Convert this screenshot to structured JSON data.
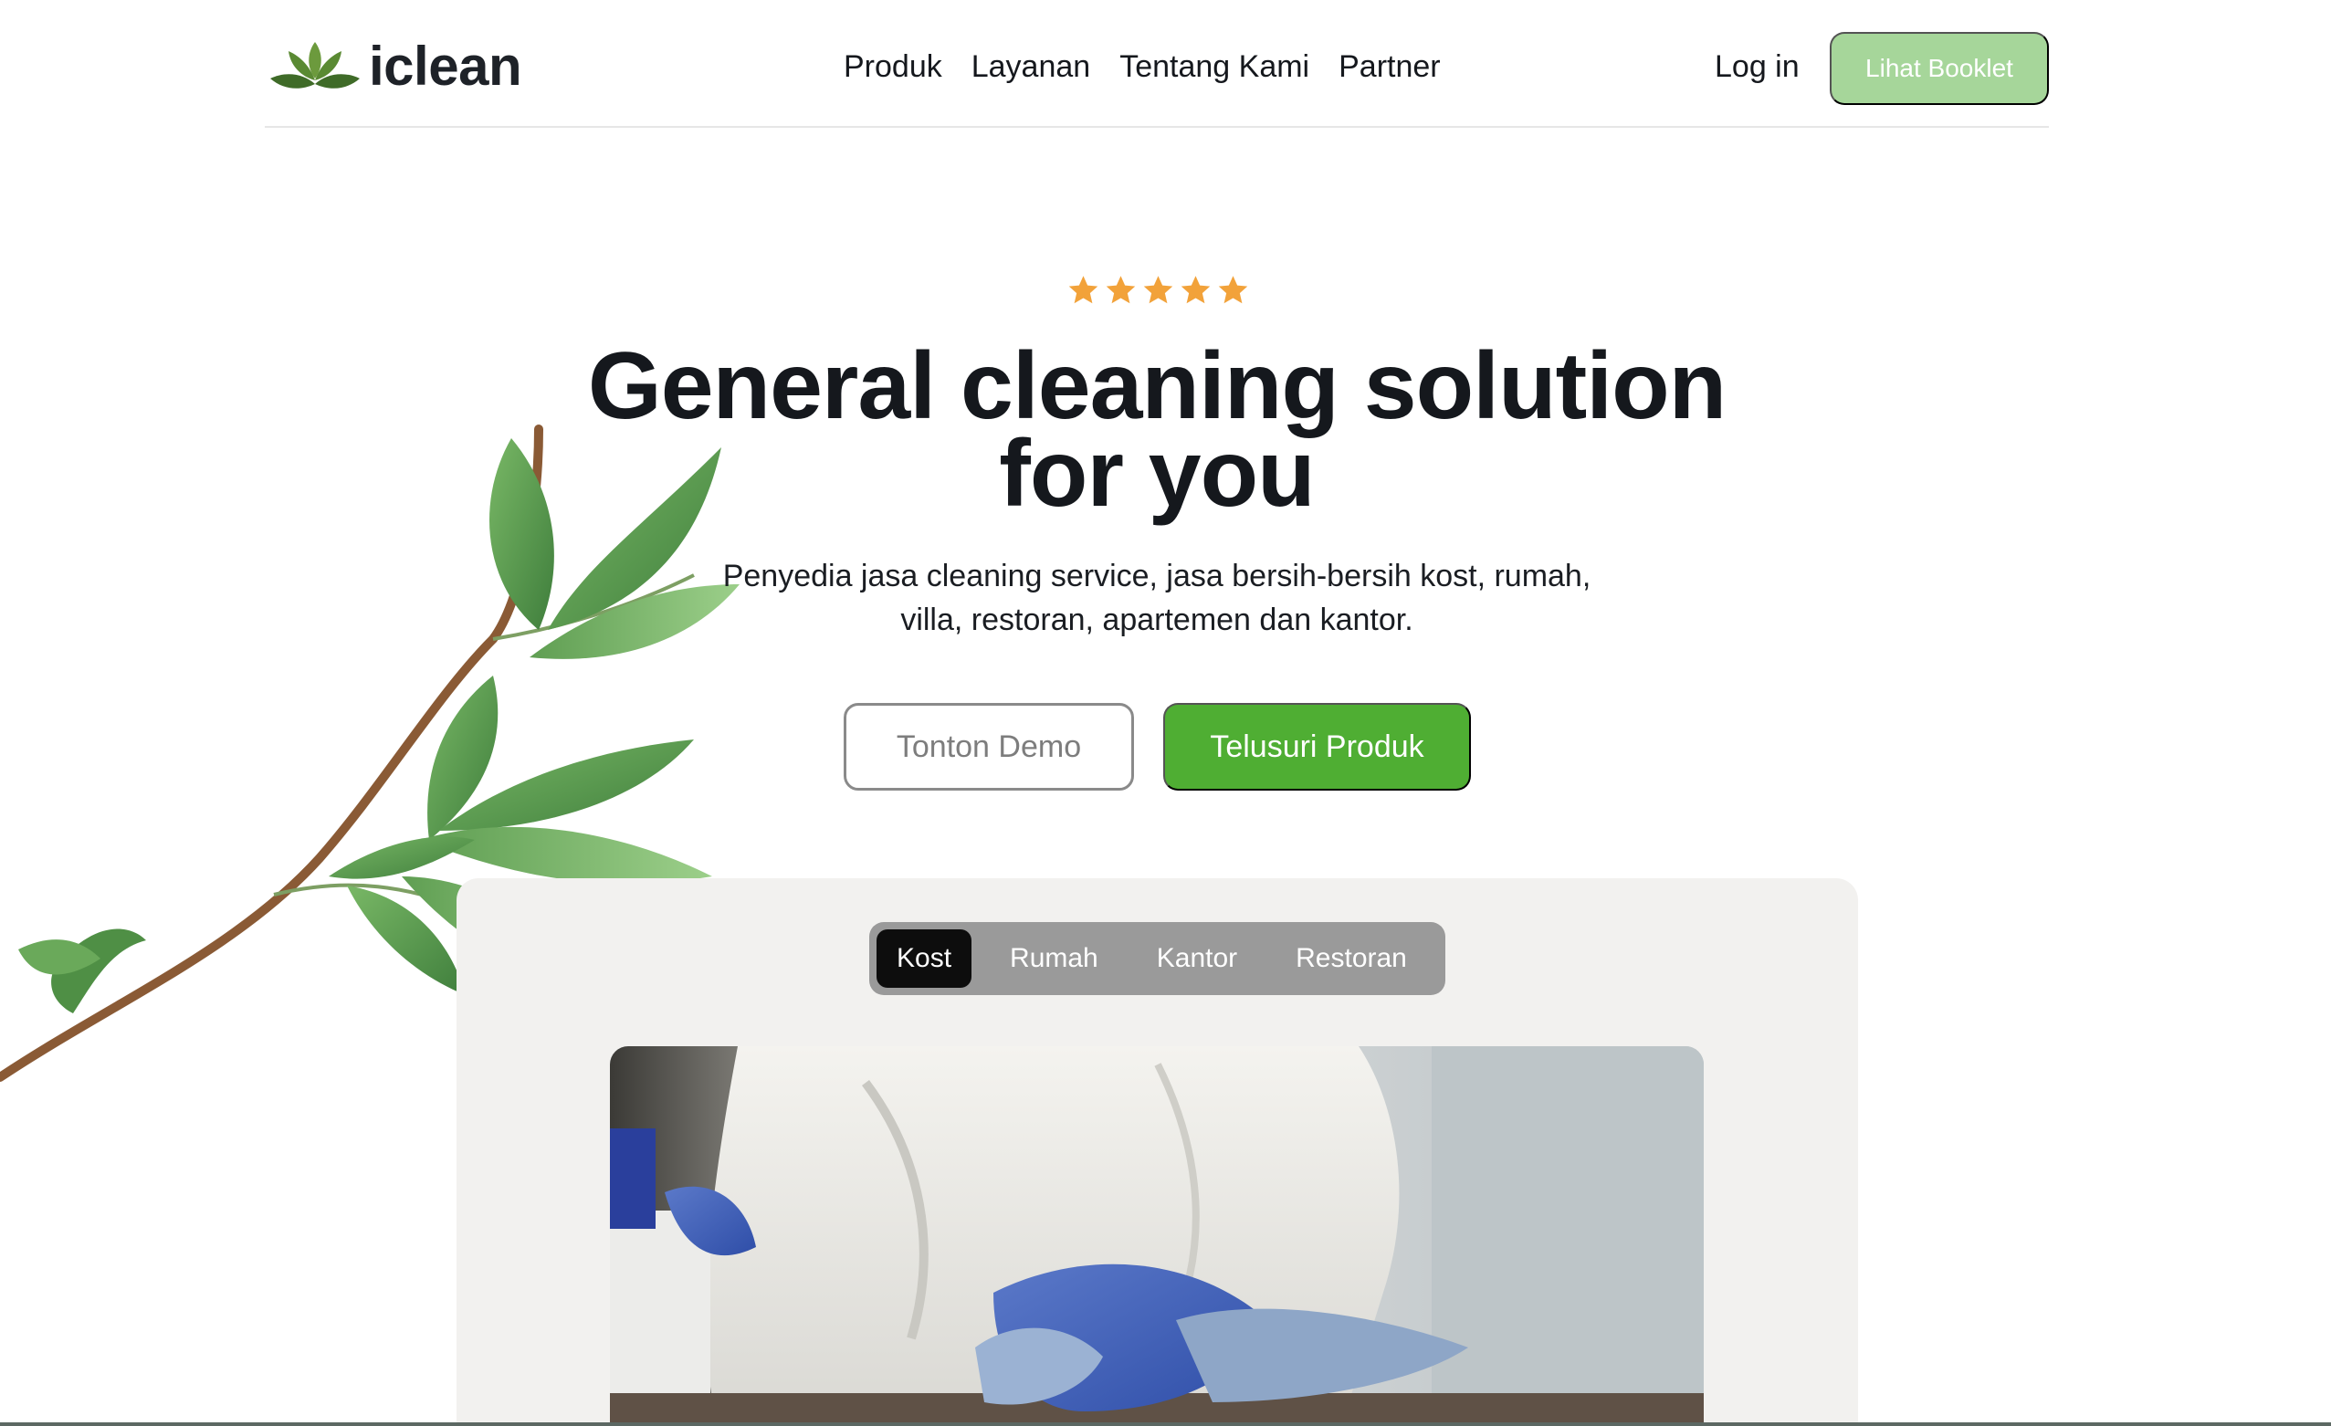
{
  "brand": {
    "name": "iclean",
    "logo_icon": "lotus-leaf-icon"
  },
  "nav": {
    "items": [
      {
        "label": "Produk"
      },
      {
        "label": "Layanan"
      },
      {
        "label": "Tentang Kami"
      },
      {
        "label": "Partner"
      }
    ],
    "login_label": "Log in",
    "booklet_label": "Lihat Booklet"
  },
  "hero": {
    "rating": {
      "stars": 5,
      "max": 5,
      "icon": "star-icon",
      "color": "#f2a23a"
    },
    "title_line1": "General cleaning solution",
    "title_line2": "for you",
    "subtitle_line1": "Penyedia jasa cleaning service, jasa bersih-bersih kost, rumah,",
    "subtitle_line2": "villa, restoran, apartemen dan kantor.",
    "demo_label": "Tonton Demo",
    "explore_label": "Telusuri Produk"
  },
  "showcase": {
    "tabs": [
      {
        "label": "Kost",
        "active": true
      },
      {
        "label": "Rumah",
        "active": false
      },
      {
        "label": "Kantor",
        "active": false
      },
      {
        "label": "Restoran",
        "active": false
      }
    ],
    "photo_subject": "cleaner-wiping-table-image"
  },
  "colors": {
    "accent_green": "#4fae33",
    "light_green": "#a6d69a",
    "star": "#f2a23a",
    "text": "#15181d",
    "panel_bg": "#f2f1ef",
    "tabs_bg": "#9a9a9a"
  }
}
